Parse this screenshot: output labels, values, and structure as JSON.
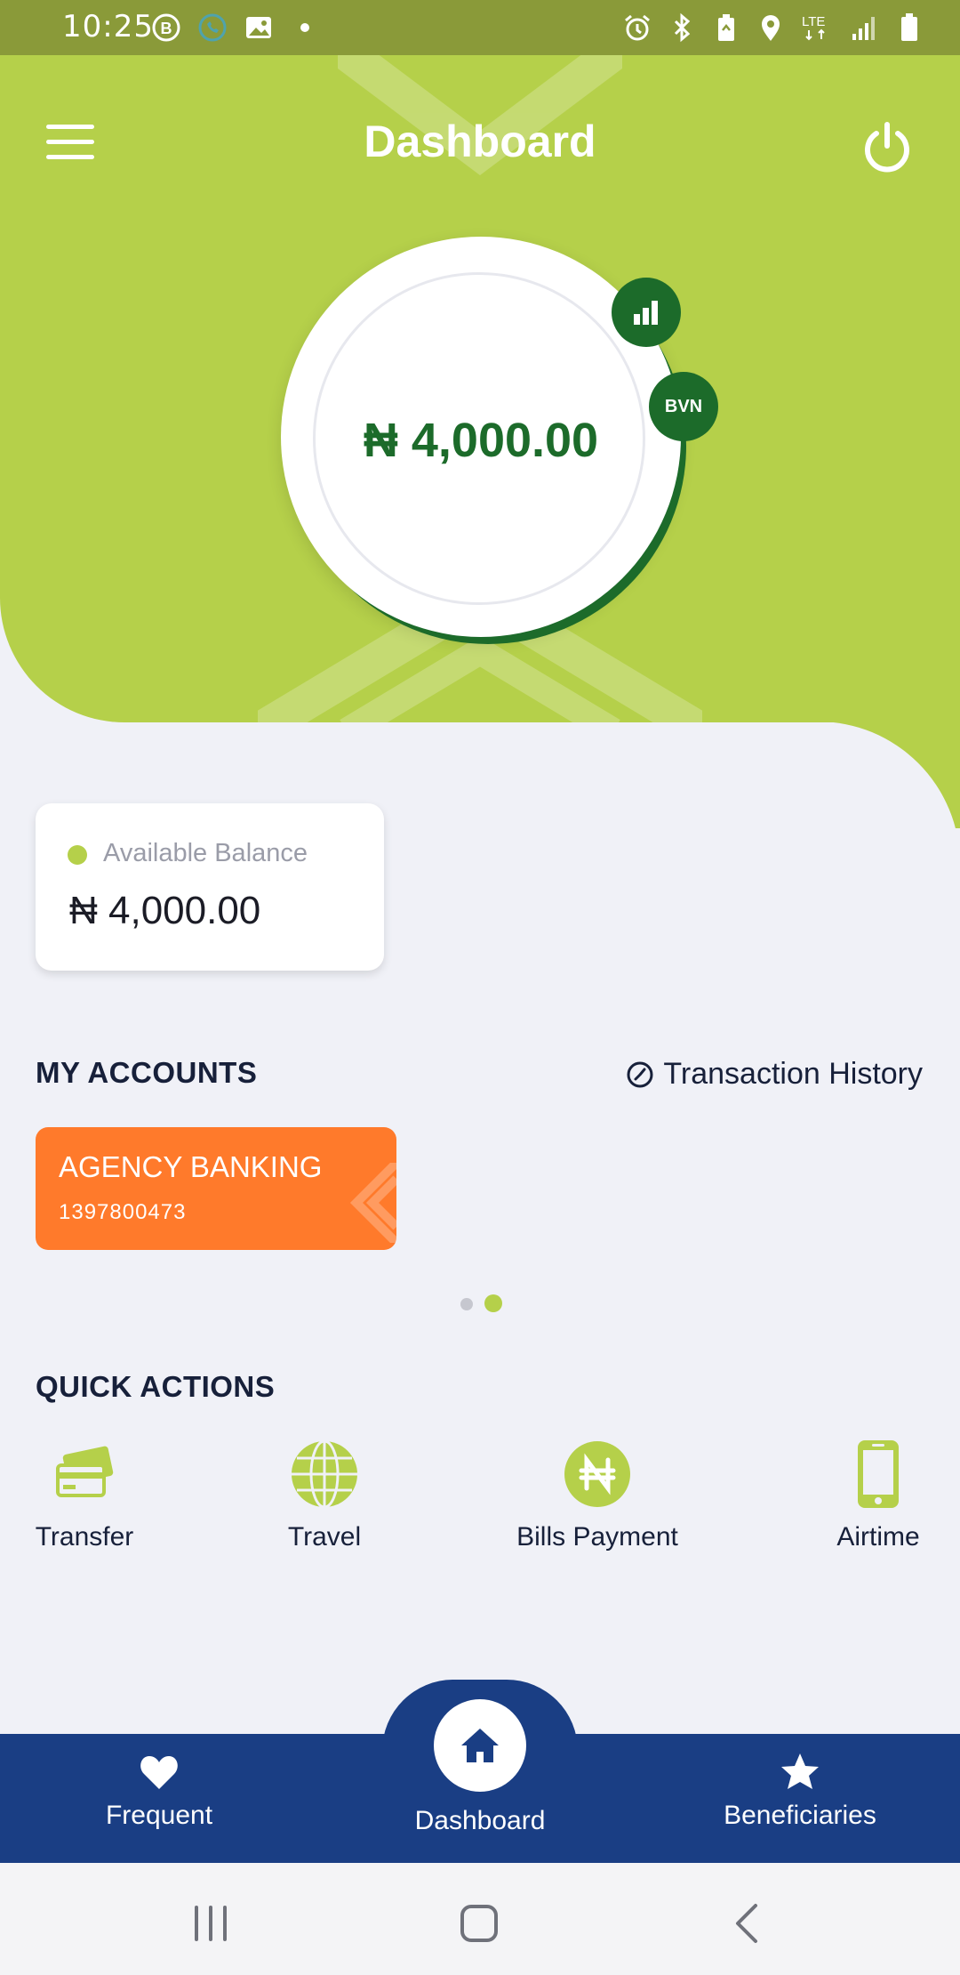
{
  "status_bar": {
    "time": "10:25",
    "left_icons": [
      "b-badge-icon",
      "whatsapp-icon",
      "image-icon",
      "dot-icon"
    ],
    "right_icons": [
      "alarm-icon",
      "bluetooth-icon",
      "battery-saver-icon",
      "location-icon",
      "lte-icon",
      "signal-icon",
      "battery-icon"
    ],
    "network_label": "LTE"
  },
  "header": {
    "title": "Dashboard",
    "menu_icon": "hamburger-menu-icon",
    "power_icon": "power-icon"
  },
  "balance_ring": {
    "amount": "₦ 4,000.00",
    "badges": {
      "stats_icon": "bar-chart-icon",
      "bvn_label": "BVN"
    }
  },
  "available_balance": {
    "label": "Available Balance",
    "amount": "₦ 4,000.00"
  },
  "accounts": {
    "section_title": "MY ACCOUNTS",
    "history_link": "Transaction History",
    "history_icon": "clock-icon",
    "cards": [
      {
        "name": "AGENCY BANKING",
        "number": "1397800473",
        "color": "#ff7a2b"
      }
    ],
    "pager": {
      "count": 2,
      "active_index": 1
    }
  },
  "quick_actions": {
    "section_title": "QUICK ACTIONS",
    "items": [
      {
        "label": "Transfer",
        "icon": "cards-icon"
      },
      {
        "label": "Travel",
        "icon": "globe-icon"
      },
      {
        "label": "Bills Payment",
        "icon": "naira-coin-icon"
      },
      {
        "label": "Airtime",
        "icon": "phone-icon"
      }
    ]
  },
  "bottom_nav": {
    "items": [
      {
        "label": "Frequent",
        "icon": "heart-icon"
      },
      {
        "label": "Dashboard",
        "icon": "home-icon"
      },
      {
        "label": "Beneficiaries",
        "icon": "star-icon"
      }
    ]
  },
  "system_nav": {
    "buttons": [
      "recents-icon",
      "home-button-icon",
      "back-icon"
    ]
  },
  "colors": {
    "accent_green": "#b5d04a",
    "dark_green": "#1c6b2a",
    "navy": "#1a3e84",
    "orange": "#ff7a2b",
    "background": "#f0f1f7"
  }
}
